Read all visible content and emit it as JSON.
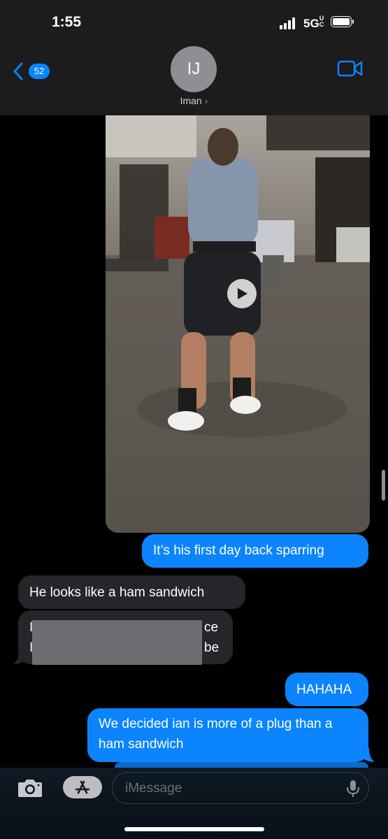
{
  "status": {
    "time": "1:55",
    "network": "5G",
    "network_suffix": "UC"
  },
  "header": {
    "back_count": "52",
    "avatar_initials": "IJ",
    "contact_name": "Iman",
    "contact_chevron": "›"
  },
  "thread": {
    "video_message": {
      "kind": "video",
      "icon": "play-icon"
    },
    "messages": [
      {
        "side": "sent",
        "text": "It’s his first day back sparring"
      },
      {
        "side": "received",
        "text": "He looks like a ham sandwich"
      },
      {
        "side": "received",
        "redacted": true,
        "visible_fragments": [
          "ce",
          "be"
        ]
      },
      {
        "side": "sent",
        "text": "HAHAHA"
      },
      {
        "side": "sent",
        "text": "We decided ian is more of a plug than a ham sandwich"
      }
    ]
  },
  "composer": {
    "placeholder": "iMessage"
  },
  "colors": {
    "sent_bubble": "#0b84fe",
    "received_bubble": "#26252a",
    "header_bg": "#1c1c1e",
    "accent": "#0a84ff"
  }
}
